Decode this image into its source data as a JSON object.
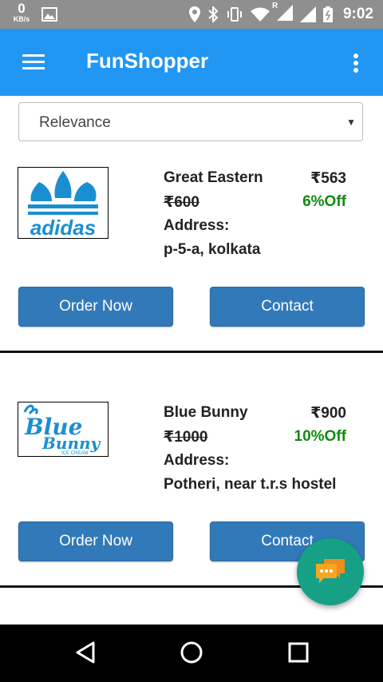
{
  "status_bar": {
    "net_speed": "0",
    "net_unit": "KB/s",
    "roaming": "R",
    "time": "9:02"
  },
  "app_bar": {
    "title": "FunShopper",
    "menu_icon": "hamburger-menu-icon",
    "more_icon": "more-vert-icon"
  },
  "sort": {
    "selected": "Relevance"
  },
  "listings": [
    {
      "name": "Great Eastern",
      "price": "₹563",
      "original_price": "₹600",
      "discount": "6%Off",
      "address_label": "Address:",
      "address": "p-5-a, kolkata",
      "logo_text": "adidas",
      "order_label": "Order Now",
      "contact_label": "Contact"
    },
    {
      "name": "Blue Bunny",
      "price": "₹900",
      "original_price": "₹1000",
      "discount": "10%Off",
      "address_label": "Address:",
      "address": "Potheri, near t.r.s hostel",
      "logo_text": "Blue Bunny",
      "logo_subtext": "ICE CREAM",
      "order_label": "Order Now",
      "contact_label": "Contact"
    }
  ],
  "fab": {
    "icon": "chat-bubbles-icon"
  },
  "nav_bar": {
    "back_icon": "back-triangle-icon",
    "home_icon": "home-circle-icon",
    "recents_icon": "recents-square-icon"
  },
  "colors": {
    "status_bar": "#8f8f8f",
    "app_bar": "#2196f3",
    "button": "#3279b9",
    "discount": "#128a12",
    "fab": "#16a085",
    "logo_blue": "#1a8fd0"
  }
}
